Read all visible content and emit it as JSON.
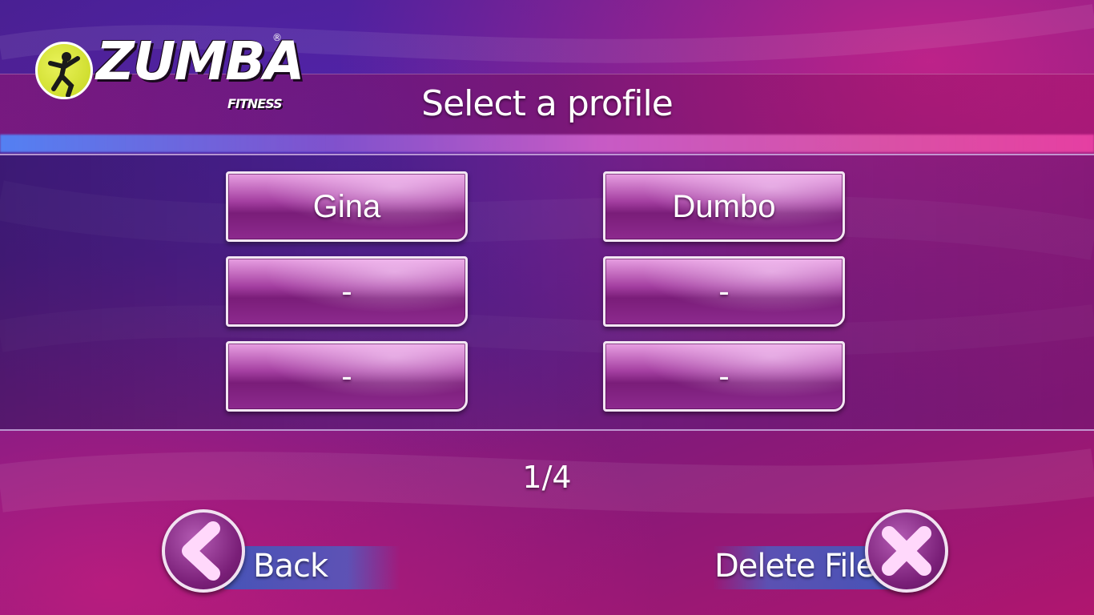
{
  "logo": {
    "brand": "ZUMBA",
    "sub": "FITNESS",
    "reg": "®"
  },
  "header": {
    "title": "Select a profile"
  },
  "profiles": [
    {
      "label": "Gina"
    },
    {
      "label": "Dumbo"
    },
    {
      "label": "-"
    },
    {
      "label": "-"
    },
    {
      "label": "-"
    },
    {
      "label": "-"
    }
  ],
  "pagination": {
    "text": "1/4"
  },
  "nav": {
    "back_label": "Back",
    "delete_label": "Delete Files"
  },
  "colors": {
    "accent": "#a43fa1",
    "logo_yellow": "#d4e232",
    "strip_blue": "#4664c8"
  }
}
